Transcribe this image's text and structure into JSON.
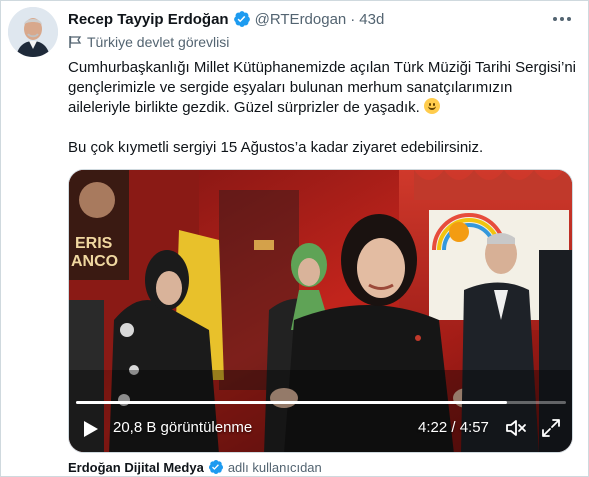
{
  "author": {
    "name": "Recep Tayyip Erdoğan",
    "handle": "@RTErdogan",
    "separator": "·",
    "time": "43d",
    "label": "Türkiye devlet görevlisi"
  },
  "tweet": {
    "paragraph1": "Cumhurbaşkanlığı Millet Kütüphanemizde açılan Türk Müziği Tarihi Sergisi’ni gençlerimizle ve sergide eşyaları bulunan merhum sanatçılarımızın aileleriyle birlikte gezdik. Güzel sürprizler de yaşadık.",
    "paragraph2": "Bu çok kıymetli sergiyi 15 Ağustos’a kadar ziyaret edebilirsiniz."
  },
  "video": {
    "views": "20,8 B görüntülenme",
    "timecode": "4:22 / 4:57",
    "progress_fraction": 0.88,
    "wall_text_1": "ERIS",
    "wall_text_2": "ANCO"
  },
  "footer": {
    "name": "Erdoğan Dijital Medya",
    "suffix": "adlı kullanıcıdan"
  },
  "colors": {
    "verified": "#1d9bf0",
    "secondary_text": "#536471",
    "primary_text": "#0f1419"
  }
}
